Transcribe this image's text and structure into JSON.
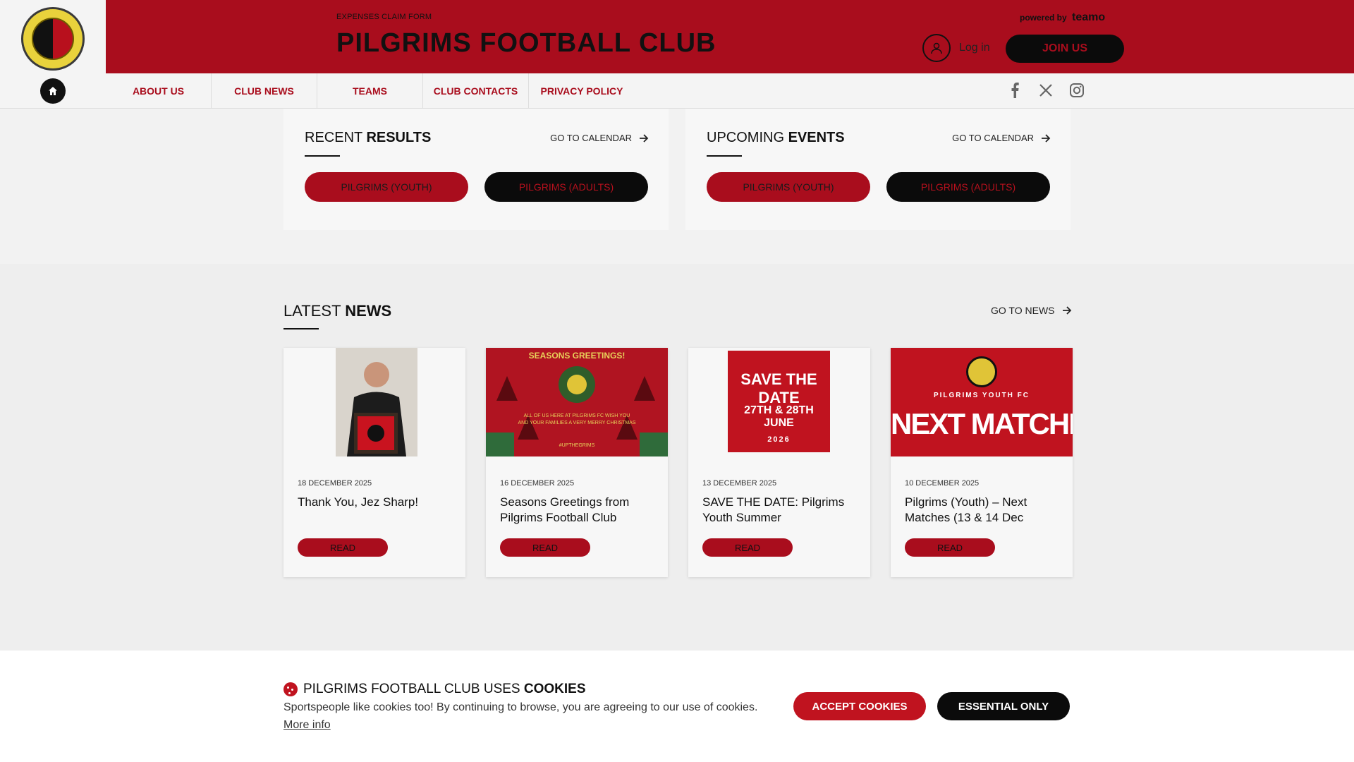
{
  "header": {
    "eyebrow": "EXPENSES CLAIM FORM",
    "club_name": "PILGRIMS FOOTBALL CLUB",
    "powered_by": "powered by",
    "brand": "teamo",
    "login_label": "Log in",
    "join_label": "JOIN US"
  },
  "nav": {
    "items": [
      {
        "label": "ABOUT US"
      },
      {
        "label": "CLUB NEWS"
      },
      {
        "label": "TEAMS"
      },
      {
        "label": "CLUB CONTACTS"
      },
      {
        "label": "PRIVACY POLICY"
      }
    ],
    "socials": [
      "facebook-icon",
      "x-icon",
      "instagram-icon"
    ]
  },
  "results": {
    "title_light": "RECENT",
    "title_bold": "RESULTS",
    "link": "GO TO CALENDAR",
    "buttons": [
      "PILGRIMS (YOUTH)",
      "PILGRIMS (ADULTS)"
    ]
  },
  "events": {
    "title_light": "UPCOMING",
    "title_bold": "EVENTS",
    "link": "GO TO CALENDAR",
    "buttons": [
      "PILGRIMS (YOUTH)",
      "PILGRIMS (ADULTS)"
    ]
  },
  "news": {
    "title_light": "LATEST",
    "title_bold": "NEWS",
    "link": "GO TO NEWS",
    "cards": [
      {
        "date": "18 DECEMBER 2025",
        "title": "Thank You, Jez Sharp!",
        "read": "READ"
      },
      {
        "date": "16 DECEMBER 2025",
        "title": "Seasons Greetings from Pilgrims Football Club",
        "read": "READ",
        "image_text": "SEASONS GREETINGS!"
      },
      {
        "date": "13 DECEMBER 2025",
        "title": "SAVE THE DATE: Pilgrims Youth Summer",
        "read": "READ",
        "image_text": "SAVE THE DATE",
        "image_sub": "27TH & 28TH JUNE",
        "image_year": "2026"
      },
      {
        "date": "10 DECEMBER 2025",
        "title": "Pilgrims (Youth) – Next Matches (13 & 14 Dec",
        "read": "READ",
        "image_text": "NEXT MATCHES",
        "image_sub": "PILGRIMS YOUTH FC"
      }
    ]
  },
  "cookie": {
    "title_light": "PILGRIMS FOOTBALL CLUB USES",
    "title_bold": "COOKIES",
    "text": "Sportspeople like cookies too! By continuing to browse, you are agreeing to our use of cookies.",
    "more": "More info",
    "accept": "ACCEPT COOKIES",
    "essential": "ESSENTIAL ONLY"
  },
  "colors": {
    "brand_red": "#a90d1d",
    "black": "#0b0b0b",
    "cookie_red": "#c0131f"
  }
}
